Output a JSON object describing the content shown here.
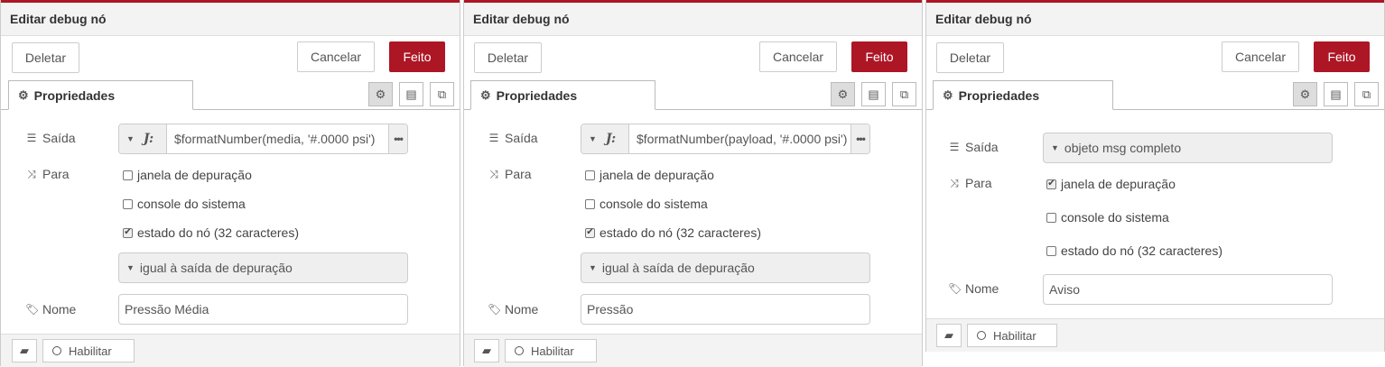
{
  "panels": [
    {
      "title": "Editar debug nó",
      "delete_label": "Deletar",
      "cancel_label": "Cancelar",
      "done_label": "Feito",
      "tab_label": "Propriedades",
      "output_label": "Saída",
      "output_value": "$formatNumber(media, '#.0000 psi')",
      "to_label": "Para",
      "options": [
        {
          "label": "janela de depuração",
          "checked": false
        },
        {
          "label": "console do sistema",
          "checked": false
        },
        {
          "label": "estado do nó (32 caracteres)",
          "checked": true
        }
      ],
      "status_select": "igual à saída de depuração",
      "name_label": "Nome",
      "name_value": "Pressão Média",
      "enable_label": "Habilitar"
    },
    {
      "title": "Editar debug nó",
      "delete_label": "Deletar",
      "cancel_label": "Cancelar",
      "done_label": "Feito",
      "tab_label": "Propriedades",
      "output_label": "Saída",
      "output_value": "$formatNumber(payload, '#.0000 psi')",
      "to_label": "Para",
      "options": [
        {
          "label": "janela de depuração",
          "checked": false
        },
        {
          "label": "console do sistema",
          "checked": false
        },
        {
          "label": "estado do nó (32 caracteres)",
          "checked": true
        }
      ],
      "status_select": "igual à saída de depuração",
      "name_label": "Nome",
      "name_value": "Pressão",
      "enable_label": "Habilitar"
    },
    {
      "title": "Editar debug nó",
      "delete_label": "Deletar",
      "cancel_label": "Cancelar",
      "done_label": "Feito",
      "tab_label": "Propriedades",
      "output_label": "Saída",
      "output_select": "objeto msg completo",
      "to_label": "Para",
      "options": [
        {
          "label": "janela de depuração",
          "checked": true
        },
        {
          "label": "console do sistema",
          "checked": false
        },
        {
          "label": "estado do nó (32 caracteres)",
          "checked": false
        }
      ],
      "name_label": "Nome",
      "name_value": "Aviso",
      "enable_label": "Habilitar"
    }
  ],
  "colors": {
    "primary": "#ad1625"
  }
}
